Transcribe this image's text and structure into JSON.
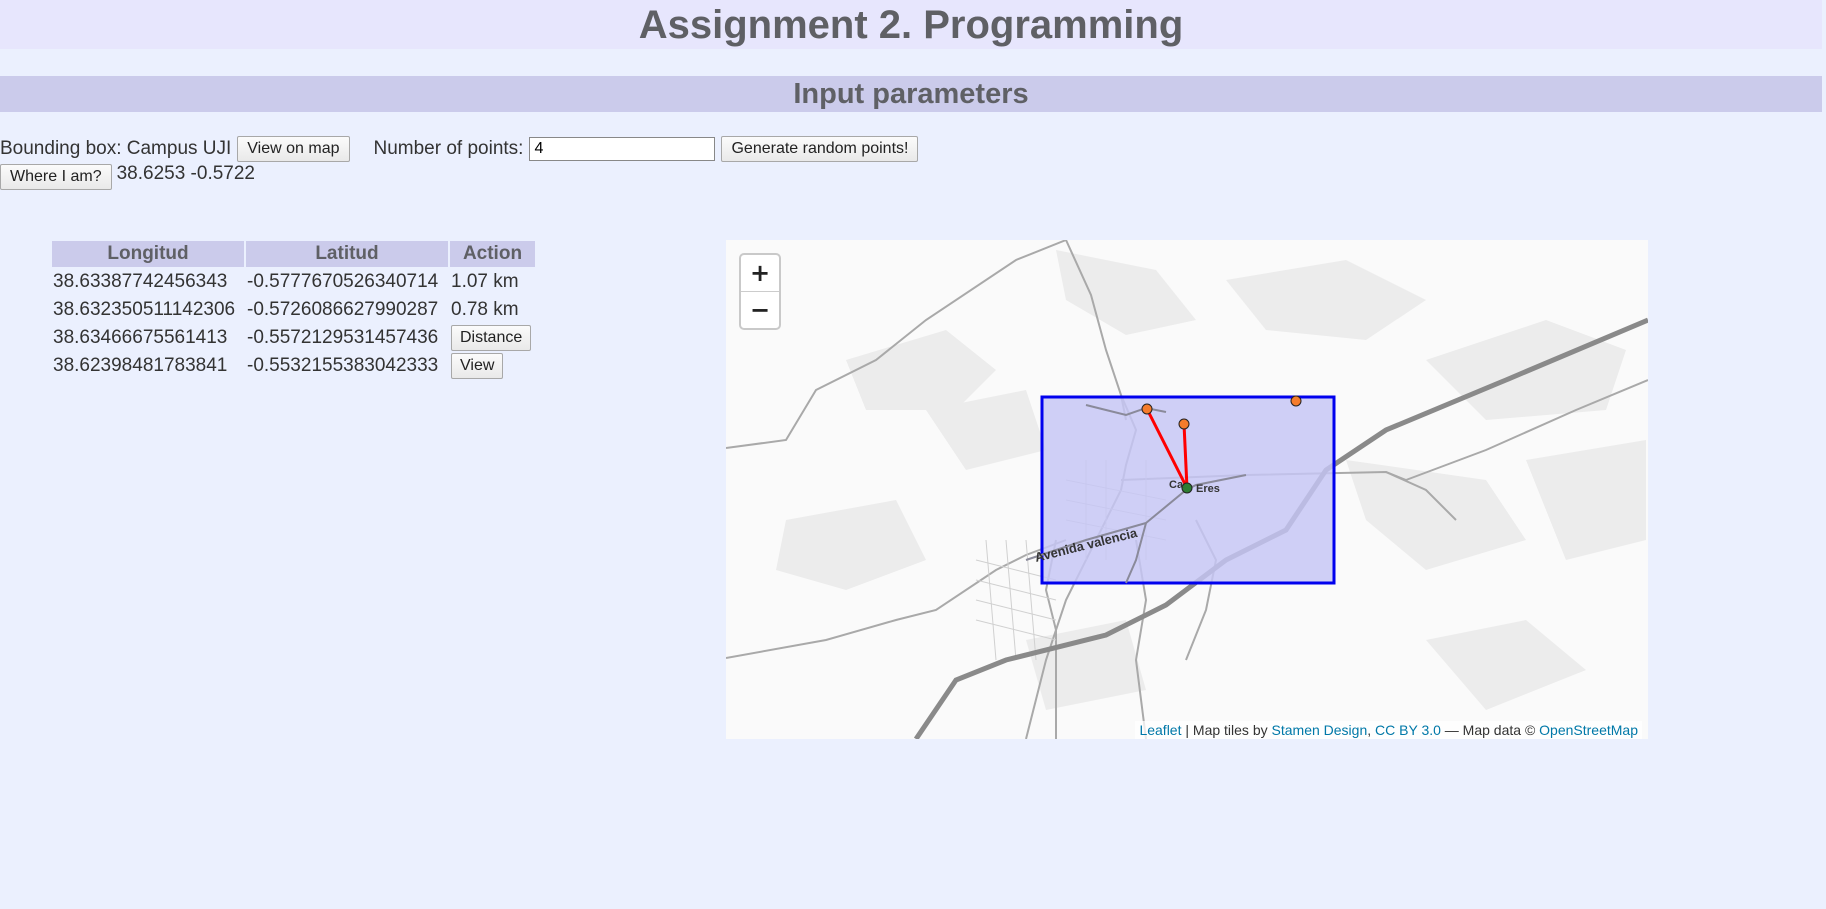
{
  "header": {
    "title": "Assignment 2. Programming",
    "subtitle": "Input parameters"
  },
  "params": {
    "bbox_label": "Bounding box: Campus UJI",
    "view_on_map_label": "View on map",
    "num_points_label": "Number of points:",
    "num_points_value": "4",
    "generate_label": "Generate random points!",
    "where_label": "Where I am?",
    "location_text": "38.6253 -0.5722"
  },
  "table": {
    "headers": [
      "Longitud",
      "Latitud",
      "Action"
    ],
    "rows": [
      {
        "lon": "38.63387742456343",
        "lat": "-0.5777670526340714",
        "action": "1.07 km"
      },
      {
        "lon": "38.632350511142306",
        "lat": "-0.5726086627990287",
        "action": "0.78 km"
      },
      {
        "lon": "38.63466675561413",
        "lat": "-0.5572129531457436",
        "action": "Distance"
      },
      {
        "lon": "38.62398481783841",
        "lat": "-0.5532155383042333",
        "action": "View"
      }
    ]
  },
  "map": {
    "zoom_in": "+",
    "zoom_out": "−",
    "street_label": "Avenida valencia",
    "place_label_1": "Ca",
    "place_label_2": "Eres",
    "attribution": {
      "leaflet": "Leaflet",
      "sep1": " | Map tiles by ",
      "stamen": "Stamen Design",
      "sep2": ", ",
      "cc": "CC BY 3.0",
      "sep3": " — Map data © ",
      "osm": "OpenStreetMap"
    },
    "colors": {
      "bbox_fill": "#c6c6f5",
      "bbox_stroke": "#0000ee",
      "line": "#ff0000",
      "marker": "#f57c2b",
      "center_marker": "#2e7d32"
    }
  }
}
